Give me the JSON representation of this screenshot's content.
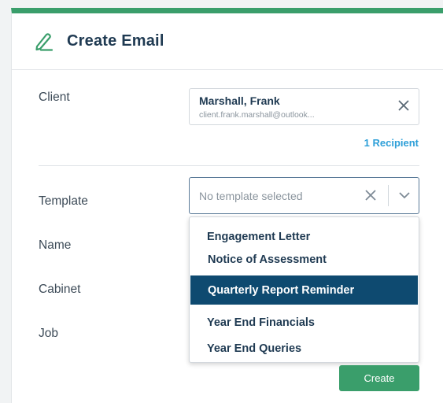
{
  "header": {
    "title": "Create Email",
    "icon": "pencil-icon"
  },
  "form": {
    "client_label": "Client",
    "template_label": "Template",
    "name_label": "Name",
    "cabinet_label": "Cabinet",
    "job_label": "Job"
  },
  "client": {
    "name": "Marshall, Frank",
    "email": "client.frank.marshall@outlook...",
    "recipients": "1 Recipient"
  },
  "template": {
    "placeholder": "No template selected",
    "options": [
      "Engagement Letter",
      "Notice of Assessment",
      "Quarterly Report Reminder",
      "Year End Financials",
      "Year End Queries"
    ],
    "highlighted": "Quarterly Report Reminder"
  },
  "actions": {
    "create_label": "Create"
  },
  "colors": {
    "accent": "#3a9e6b",
    "heading": "#1f3a52",
    "link": "#2d9fd8",
    "selected_bg": "#0e4a70"
  }
}
